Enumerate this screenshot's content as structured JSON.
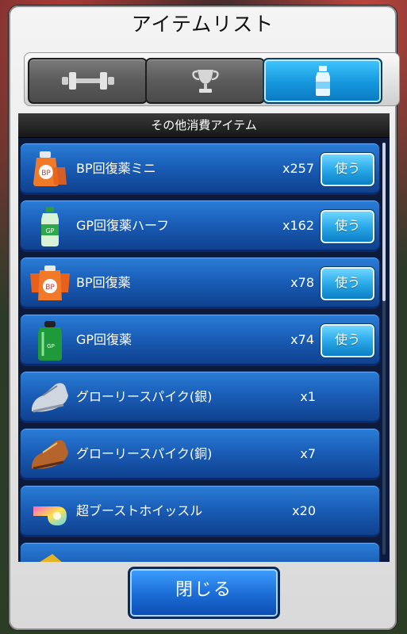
{
  "dialog": {
    "title": "アイテムリスト",
    "tabs": [
      {
        "icon": "dumbbell-icon",
        "active": false
      },
      {
        "icon": "trophy-icon",
        "active": false
      },
      {
        "icon": "bottle-icon",
        "active": true
      }
    ],
    "section_header": "その他消費アイテム",
    "close_label": "閉じる"
  },
  "items": [
    {
      "name": "BP回復薬ミニ",
      "qty": "x257",
      "use_label": "使う",
      "icon": "bp-pouch-mini-icon"
    },
    {
      "name": "GP回復薬ハーフ",
      "qty": "x162",
      "use_label": "使う",
      "icon": "gp-bottle-half-icon"
    },
    {
      "name": "BP回復薬",
      "qty": "x78",
      "use_label": "使う",
      "icon": "bp-pouch-pack-icon"
    },
    {
      "name": "GP回復薬",
      "qty": "x74",
      "use_label": "使う",
      "icon": "gp-bottle-icon"
    },
    {
      "name": "グローリースパイク(銀)",
      "qty": "x1",
      "icon": "silver-spike-shoe-icon"
    },
    {
      "name": "グローリースパイク(銅)",
      "qty": "x7",
      "icon": "bronze-spike-shoe-icon"
    },
    {
      "name": "超ブーストホイッスル",
      "qty": "x20",
      "icon": "boost-whistle-icon"
    },
    {
      "icon": "gold-item-icon"
    }
  ],
  "colors": {
    "accent": "#1596dc",
    "row_blue": "#1a5eb7",
    "panel": "#e6e6e6"
  }
}
